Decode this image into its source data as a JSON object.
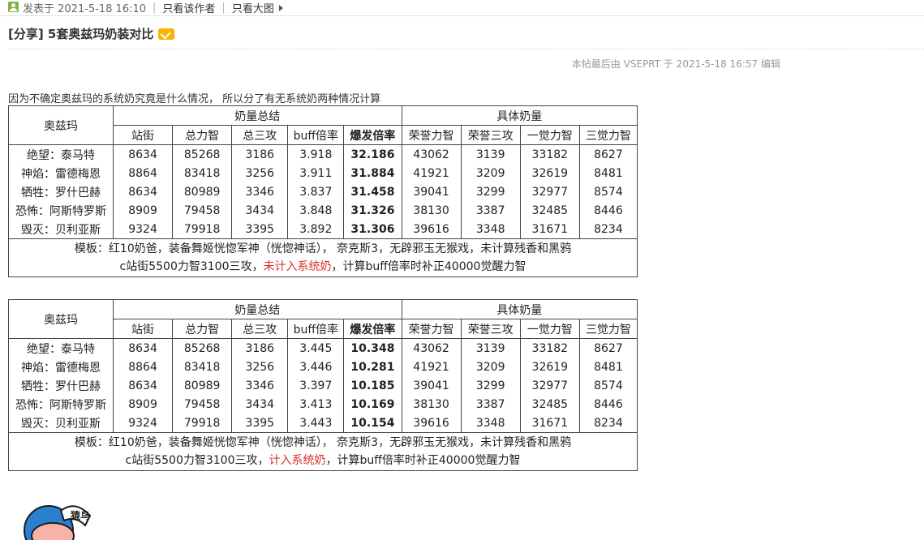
{
  "topbar": {
    "posted_at": "发表于 2021-5-18 16:10",
    "only_author": "只看该作者",
    "only_big_image": "只看大图"
  },
  "post": {
    "title": "[分享] 5套奥兹玛奶装对比",
    "edit_note": "本帖最后由 VSEPRT 于 2021-5-18 16:57 编辑",
    "intro": "因为不确定奥兹玛的系统奶究竟是什么情况， 所以分了有无系统奶两种情况计算"
  },
  "table_headers": {
    "row_header": "奥兹玛",
    "group1": "奶量总结",
    "group2": "具体奶量",
    "columns": [
      "站街",
      "总力智",
      "总三攻",
      "buff倍率",
      "爆发倍率",
      "荣誉力智",
      "荣誉三攻",
      "一觉力智",
      "三觉力智"
    ]
  },
  "table1": {
    "rows": [
      {
        "name": "绝望：泰马特",
        "v": [
          "8634",
          "85268",
          "3186",
          "3.918",
          "32.186",
          "43062",
          "3139",
          "33182",
          "8627"
        ]
      },
      {
        "name": "神焰：雷德梅恩",
        "v": [
          "8864",
          "83418",
          "3256",
          "3.911",
          "31.884",
          "41921",
          "3209",
          "32619",
          "8481"
        ]
      },
      {
        "name": "牺牲：罗什巴赫",
        "v": [
          "8634",
          "80989",
          "3346",
          "3.837",
          "31.458",
          "39041",
          "3299",
          "32977",
          "8574"
        ]
      },
      {
        "name": "恐怖：阿斯特罗斯",
        "v": [
          "8909",
          "79458",
          "3434",
          "3.848",
          "31.326",
          "38130",
          "3387",
          "32485",
          "8446"
        ]
      },
      {
        "name": "毁灭：贝利亚斯",
        "v": [
          "9324",
          "79918",
          "3395",
          "3.892",
          "31.306",
          "39616",
          "3348",
          "31671",
          "8234"
        ]
      }
    ],
    "note_line1": "模板：红10奶爸，装备舞姬恍惚军神（恍惚神话）， 奈克斯3，无辟邪玉无猴戏，未计算残香和黑鸦",
    "note_line2_a": "c站街5500力智3100三攻，",
    "note_line2_red": "未计入系统奶",
    "note_line2_b": "，计算buff倍率时补正40000觉醒力智"
  },
  "table2": {
    "rows": [
      {
        "name": "绝望：泰马特",
        "v": [
          "8634",
          "85268",
          "3186",
          "3.445",
          "10.348",
          "43062",
          "3139",
          "33182",
          "8627"
        ]
      },
      {
        "name": "神焰：雷德梅恩",
        "v": [
          "8864",
          "83418",
          "3256",
          "3.446",
          "10.281",
          "41921",
          "3209",
          "32619",
          "8481"
        ]
      },
      {
        "name": "牺牲：罗什巴赫",
        "v": [
          "8634",
          "80989",
          "3346",
          "3.397",
          "10.185",
          "39041",
          "3299",
          "32977",
          "8574"
        ]
      },
      {
        "name": "恐怖：阿斯特罗斯",
        "v": [
          "8909",
          "79458",
          "3434",
          "3.413",
          "10.169",
          "38130",
          "3387",
          "32485",
          "8446"
        ]
      },
      {
        "name": "毁灭：贝利亚斯",
        "v": [
          "9324",
          "79918",
          "3395",
          "3.443",
          "10.154",
          "39616",
          "3348",
          "31671",
          "8234"
        ]
      }
    ],
    "note_line1": "模板：红10奶爸，装备舞姬恍惚军神（恍惚神话）， 奈克斯3，无辟邪玉无猴戏，未计算残香和黑鸦",
    "note_line2_a": "c站街5500力智3100三攻，",
    "note_line2_red": "计入系统奶",
    "note_line2_b": "，计算buff倍率时补正40000觉醒力智"
  },
  "avatar": {
    "label": "猿鸟"
  },
  "colors": {
    "accent_red": "#d9302c",
    "user_icon": "#7cb342",
    "badge": "#f5b400"
  }
}
